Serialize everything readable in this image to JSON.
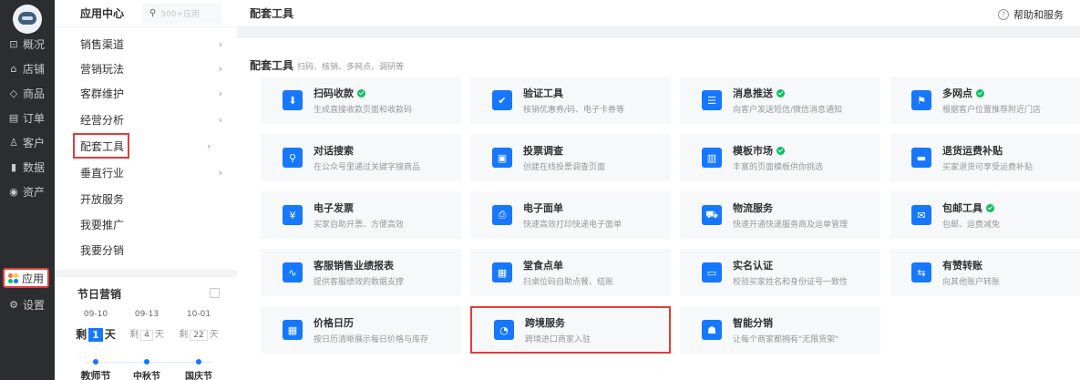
{
  "nav": {
    "items": [
      {
        "label": "概况",
        "icon": "monitor-icon"
      },
      {
        "label": "店铺",
        "icon": "store-icon"
      },
      {
        "label": "商品",
        "icon": "tag-icon"
      },
      {
        "label": "订单",
        "icon": "list-icon"
      },
      {
        "label": "客户",
        "icon": "user-icon"
      },
      {
        "label": "数据",
        "icon": "bar-chart-icon"
      },
      {
        "label": "资产",
        "icon": "coin-icon"
      }
    ],
    "app": {
      "label": "应用",
      "icon": "apps-icon"
    },
    "settings": {
      "label": "设置",
      "icon": "gear-icon"
    }
  },
  "sidebar": {
    "title": "应用中心",
    "search_placeholder": "500+应用",
    "items": [
      {
        "label": "销售渠道",
        "arrow": "›"
      },
      {
        "label": "营销玩法",
        "arrow": "›"
      },
      {
        "label": "客群维护",
        "arrow": "›"
      },
      {
        "label": "经营分析",
        "arrow": "›"
      },
      {
        "label": "配套工具",
        "arrow": "›"
      },
      {
        "label": "垂直行业",
        "arrow": "›"
      },
      {
        "label": "开放服务",
        "arrow": ""
      },
      {
        "label": "我要推广",
        "arrow": ""
      },
      {
        "label": "我要分销",
        "arrow": ""
      }
    ]
  },
  "festival": {
    "title": "节日营销",
    "items": [
      {
        "date": "09-10",
        "prefix": "剩",
        "days": "1",
        "suffix": "天",
        "name": "教师节"
      },
      {
        "date": "09-13",
        "prefix": "剩",
        "days": "4",
        "suffix": "天",
        "name": "中秋节"
      },
      {
        "date": "10-01",
        "prefix": "剩",
        "days": "22",
        "suffix": "天",
        "name": "国庆节"
      }
    ]
  },
  "header": {
    "title": "配套工具",
    "help": "帮助和服务"
  },
  "section": {
    "title": "配套工具",
    "subtitle": "扫码、核销、多网点、调研等"
  },
  "cards": [
    {
      "name": "扫码收款",
      "desc": "生成直接收款页面和收款码",
      "badge": true,
      "icon": "download-arrow-icon"
    },
    {
      "name": "验证工具",
      "desc": "核销优惠券/码、电子卡券等",
      "badge": false,
      "icon": "shield-check-icon"
    },
    {
      "name": "消息推送",
      "desc": "向客户发送短信/微信消息通知",
      "badge": true,
      "icon": "message-icon"
    },
    {
      "name": "多网点",
      "desc": "根据客户位置推荐附近门店",
      "badge": true,
      "icon": "location-icon"
    },
    {
      "name": "对话搜索",
      "desc": "在公众号里通过关键字搜商品",
      "badge": false,
      "icon": "search-icon"
    },
    {
      "name": "投票调查",
      "desc": "创建在线投票调查页面",
      "badge": false,
      "icon": "vote-icon"
    },
    {
      "name": "模板市场",
      "desc": "丰富的页面模板供你挑选",
      "badge": true,
      "icon": "layout-icon"
    },
    {
      "name": "退货运费补贴",
      "desc": "买家退货可享受运费补贴",
      "badge": false,
      "icon": "wallet-icon"
    },
    {
      "name": "电子发票",
      "desc": "买家自助开票、方便高效",
      "badge": false,
      "icon": "invoice-icon"
    },
    {
      "name": "电子面单",
      "desc": "快速高效打印快递电子面单",
      "badge": false,
      "icon": "printer-icon"
    },
    {
      "name": "物流服务",
      "desc": "快速开通快递服务商及运单管理",
      "badge": false,
      "icon": "truck-icon"
    },
    {
      "name": "包邮工具",
      "desc": "包邮、运费减免",
      "badge": true,
      "icon": "mail-icon"
    },
    {
      "name": "客服销售业绩报表",
      "desc": "提供客服绩效的数据支撑",
      "badge": false,
      "icon": "report-icon"
    },
    {
      "name": "堂食点单",
      "desc": "扫桌位码自助点餐、结账",
      "badge": false,
      "icon": "qrcode-icon"
    },
    {
      "name": "实名认证",
      "desc": "校验买家姓名和身份证号一致性",
      "badge": false,
      "icon": "id-card-icon"
    },
    {
      "name": "有赞转账",
      "desc": "向其他账户转账",
      "badge": false,
      "icon": "transfer-icon"
    },
    {
      "name": "价格日历",
      "desc": "按日历清晰展示每日价格与库存",
      "badge": false,
      "icon": "calendar-icon"
    },
    {
      "name": "跨境服务",
      "desc": "跨境进口商家入驻",
      "badge": false,
      "icon": "globe-icon"
    },
    {
      "name": "智能分销",
      "desc": "让每个商家都拥有\"无限货架\"",
      "badge": false,
      "icon": "distribution-icon"
    }
  ]
}
